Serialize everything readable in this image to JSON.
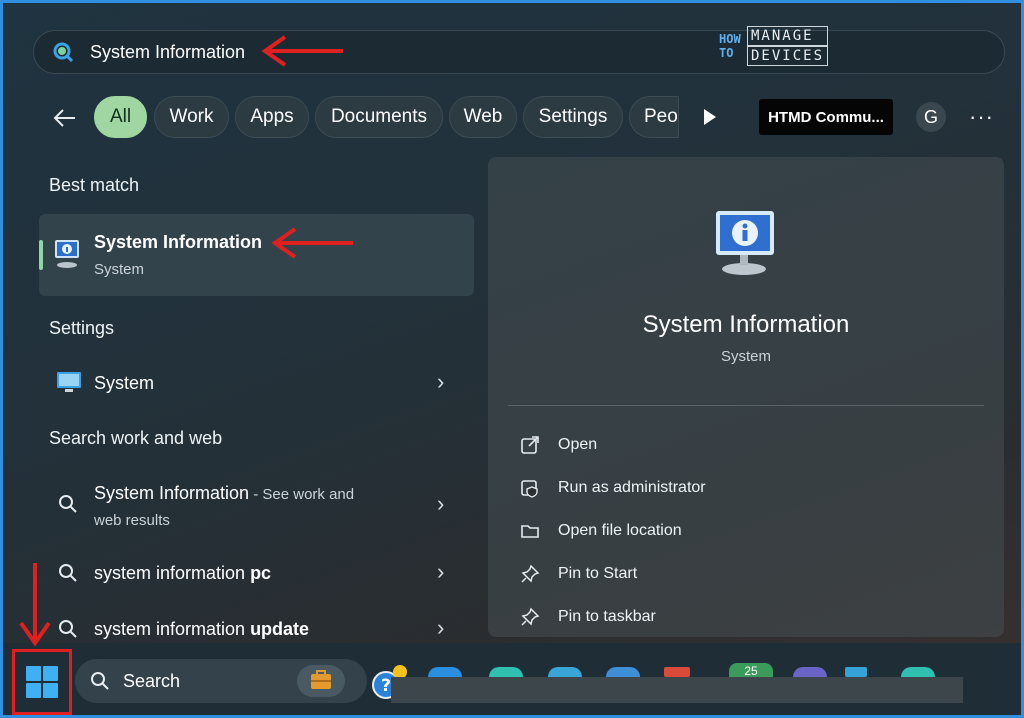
{
  "search": {
    "value": "System Information"
  },
  "logo": {
    "how": "HOW",
    "to": "TO",
    "manage": "MANAGE",
    "devices": "DEVICES"
  },
  "filters": [
    {
      "label": "All",
      "active": true
    },
    {
      "label": "Work"
    },
    {
      "label": "Apps"
    },
    {
      "label": "Documents"
    },
    {
      "label": "Web"
    },
    {
      "label": "Settings"
    },
    {
      "label": "Peo"
    }
  ],
  "account_chip": "HTMD Commu...",
  "avatar": "G",
  "more": "···",
  "best_match": {
    "heading": "Best match",
    "title": "System Information",
    "subtitle": "System"
  },
  "settings": {
    "heading": "Settings",
    "item": "System"
  },
  "web": {
    "heading": "Search work and web",
    "items": [
      {
        "label": "System Information",
        "suffix": " - See work and",
        "second_line": "web results"
      },
      {
        "label": "system information ",
        "bold": "pc"
      },
      {
        "label": "system information ",
        "bold": "update"
      }
    ]
  },
  "detail": {
    "title": "System Information",
    "subtitle": "System",
    "actions": [
      {
        "label": "Open",
        "icon": "open-external-icon"
      },
      {
        "label": "Run as administrator",
        "icon": "shield-admin-icon"
      },
      {
        "label": "Open file location",
        "icon": "folder-icon"
      },
      {
        "label": "Pin to Start",
        "icon": "pin-icon"
      },
      {
        "label": "Pin to taskbar",
        "icon": "pin-icon"
      }
    ]
  },
  "taskbar": {
    "search_label": "Search",
    "badge": "25"
  },
  "colors": {
    "accent": "#9fd6a2",
    "annotation": "#e02020",
    "frame": "#2f8fe0"
  }
}
